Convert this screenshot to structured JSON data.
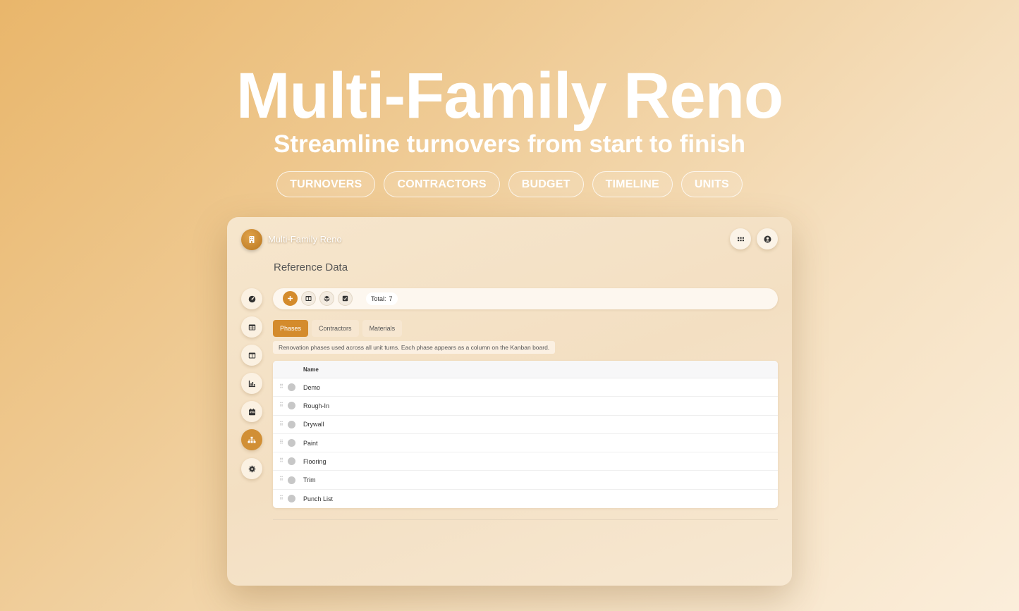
{
  "hero": {
    "title": "Multi-Family Reno",
    "subtitle": "Streamline turnovers from start to finish",
    "pills": [
      "TURNOVERS",
      "CONTRACTORS",
      "BUDGET",
      "TIMELINE",
      "UNITS"
    ]
  },
  "app": {
    "name": "Multi-Family Reno",
    "page_title": "Reference Data",
    "top_icons": [
      "grid-icon",
      "user-icon"
    ],
    "sidebar": [
      {
        "icon": "gauge-icon",
        "active": false
      },
      {
        "icon": "table-icon",
        "active": false
      },
      {
        "icon": "columns-icon",
        "active": false
      },
      {
        "icon": "chart-icon",
        "active": false
      },
      {
        "icon": "calendar-icon",
        "active": false
      },
      {
        "icon": "hierarchy-icon",
        "active": true
      },
      {
        "icon": "gear-icon",
        "active": false
      }
    ],
    "toolbar": {
      "buttons": [
        "plus-icon",
        "columns-icon",
        "layers-icon",
        "checkbox-icon"
      ],
      "total_label": "Total:",
      "total_value": "7"
    },
    "tabs": [
      {
        "label": "Phases",
        "active": true
      },
      {
        "label": "Contractors",
        "active": false
      },
      {
        "label": "Materials",
        "active": false
      }
    ],
    "description": "Renovation phases used across all unit turns. Each phase appears as a column on the Kanban board.",
    "table": {
      "header": "Name",
      "rows": [
        "Demo",
        "Rough-In",
        "Drywall",
        "Paint",
        "Flooring",
        "Trim",
        "Punch List"
      ]
    }
  },
  "colors": {
    "accent": "#d48b2c",
    "background_start": "#e9b66b",
    "background_end": "#fbeedb"
  }
}
